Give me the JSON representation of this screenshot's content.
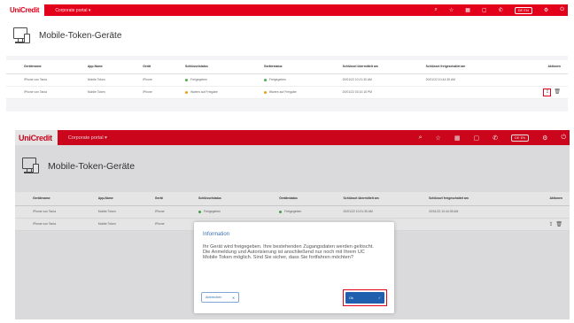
{
  "brand": {
    "logo": "UniCredit",
    "portal": "Corporate portal ▾",
    "accent": "#e2001a",
    "link": "#1f5fae"
  },
  "toolbar": {
    "icons": [
      "search-notification-icon",
      "star-icon",
      "grid-icon",
      "calendar-icon",
      "phone-icon",
      "language-badge",
      "settings-icon",
      "power-icon"
    ],
    "language": "DE EN"
  },
  "page": {
    "title": "Mobile-Token-Geräte"
  },
  "table": {
    "headers": [
      "Gerätename",
      "App-Name",
      "Gerät",
      "Schlüsselstatus",
      "Gerätestatus",
      "Schlüssel übermittelt am",
      "Schlüssel freigeschaltet am",
      "Aktionen"
    ],
    "rows": [
      {
        "name": "iPhone von Tania",
        "app": "Mobile Token",
        "device": "iPhone",
        "key_status": "Freigegeben",
        "device_status": "Freigegeben",
        "submitted": "20/01/22 10:21:30 AM",
        "activated": "20/01/22 10:44:35 AM",
        "key_color": "#4caf50",
        "device_color": "#4caf50"
      },
      {
        "name": "iPhone von Tania",
        "app": "Mobile Token",
        "device": "iPhone",
        "key_status": "Warten auf Freigabe",
        "device_status": "Warten auf Freigabe",
        "submitted": "20/01/22 03:10:16 PM",
        "activated": "",
        "key_color": "#f39c12",
        "device_color": "#f39c12"
      }
    ]
  },
  "dialog": {
    "title": "Information",
    "message": "Ihr Gerät wird freigegeben. Ihre bestehenden Zugangsdaten werden gelöscht. Die Anmeldung und Autorisierung ist anschließend nur noch mit Ihrem UC Mobile Token möglich. Sind Sie sicher, dass Sie fortfahren möchten?",
    "cancel_label": "Abbrechen",
    "ok_label": "Ok"
  }
}
